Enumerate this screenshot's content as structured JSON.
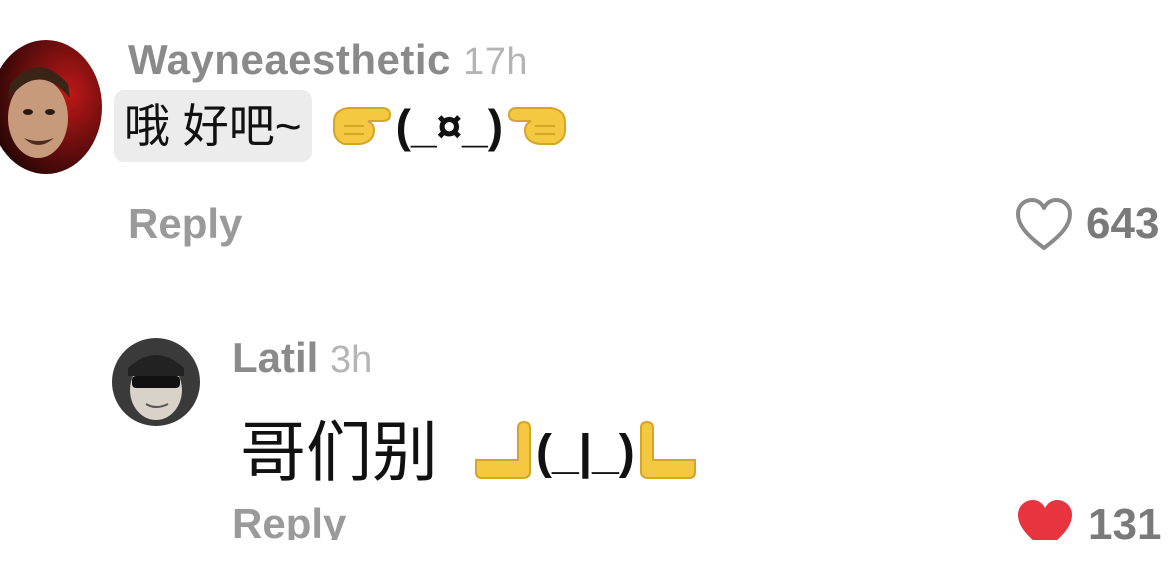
{
  "comments": [
    {
      "username": "Wayneaesthetic",
      "time": "17h",
      "text": "哦 好吧~",
      "kaomoji": "(_¤_)",
      "reply_label": "Reply",
      "like_count": "643",
      "liked": false
    },
    {
      "username": "Latil",
      "time": "3h",
      "text": "哥们别",
      "kaomoji": "(_|_)",
      "reply_label": "Reply",
      "like_count": "131",
      "liked": true
    }
  ],
  "colors": {
    "like_red": "#e8343f",
    "emoji_yellow": "#f5c842"
  },
  "icons": {
    "like_outline": "heart-outline-icon",
    "like_filled": "heart-filled-icon",
    "hand_right": "backhand-index-pointing-right-emoji",
    "hand_left": "backhand-index-pointing-left-emoji",
    "hand_up": "hand-pointing-up-emoji"
  }
}
